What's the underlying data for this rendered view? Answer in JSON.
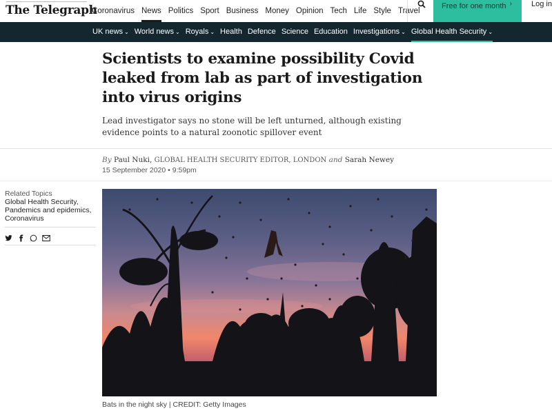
{
  "masthead": {
    "logo_text": "The Telegraph"
  },
  "top_nav": {
    "items": [
      {
        "label": "Coronavirus",
        "active": false
      },
      {
        "label": "News",
        "active": true
      },
      {
        "label": "Politics",
        "active": false
      },
      {
        "label": "Sport",
        "active": false
      },
      {
        "label": "Business",
        "active": false
      },
      {
        "label": "Money",
        "active": false
      },
      {
        "label": "Opinion",
        "active": false
      },
      {
        "label": "Tech",
        "active": false
      },
      {
        "label": "Life",
        "active": false
      },
      {
        "label": "Style",
        "active": false
      },
      {
        "label": "Travel",
        "active": false
      }
    ],
    "search_icon": "search-icon",
    "subscribe_label": "Free for one month",
    "login_label": "Log in"
  },
  "section_nav": {
    "items": [
      {
        "label": "UK news",
        "has_caret": true
      },
      {
        "label": "World news",
        "has_caret": true
      },
      {
        "label": "Royals",
        "has_caret": true
      },
      {
        "label": "Health",
        "has_caret": false
      },
      {
        "label": "Defence",
        "has_caret": false
      },
      {
        "label": "Science",
        "has_caret": false
      },
      {
        "label": "Education",
        "has_caret": false
      },
      {
        "label": "Investigations",
        "has_caret": true
      },
      {
        "label": "Global Health Security",
        "has_caret": true
      }
    ]
  },
  "article": {
    "headline": "Scientists to examine possibility Covid leaked from lab as part of investigation into virus origins",
    "standfirst": "Lead investigator says no stone will be left unturned, although existing evidence points to a natural zoonotic spillover event",
    "byline": {
      "by": "By",
      "author1": "Paul Nuki,",
      "role": "GLOBAL HEALTH SECURITY EDITOR, LONDON",
      "and": "and",
      "author2": "Sarah Newey"
    },
    "date": "15 September 2020 • 9:59pm",
    "caption": "Bats in the night sky | CREDIT: Getty Images"
  },
  "related_topics": {
    "title": "Related Topics",
    "links": [
      "Global Health Security,",
      "Pandemics and epidemics,",
      "Coronavirus"
    ]
  },
  "colors": {
    "accent": "#2dbe9f",
    "nav_bg": "#14272f"
  }
}
